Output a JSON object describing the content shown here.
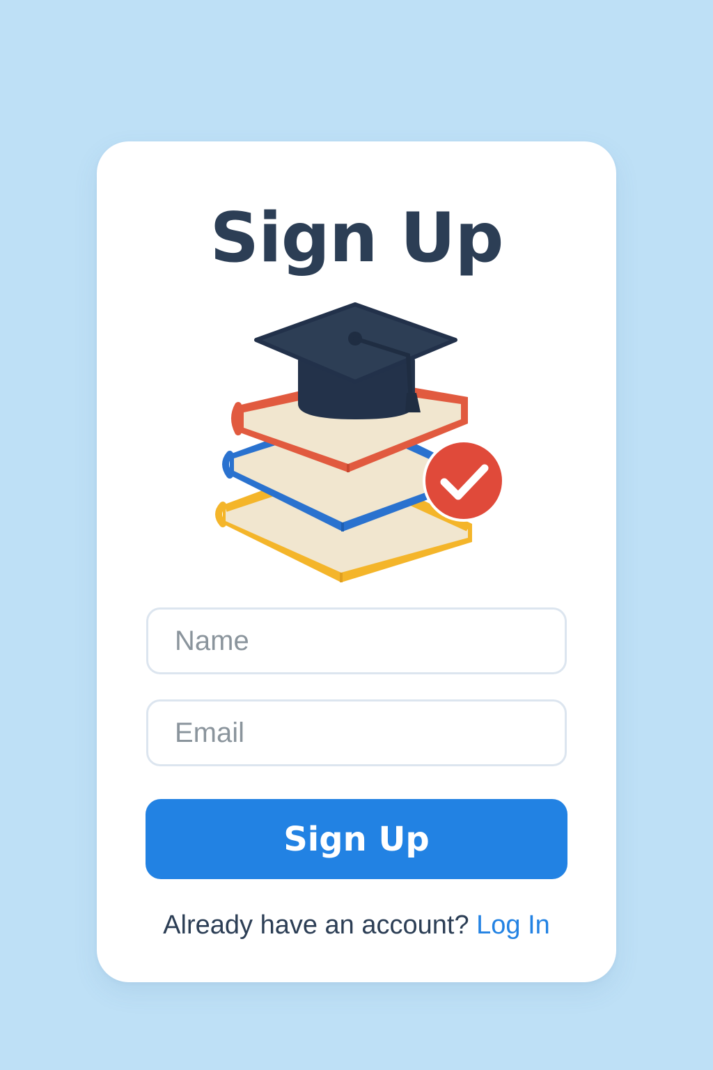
{
  "title": "Sign Up",
  "illustration": {
    "icon": "graduation-books-icon",
    "colors": {
      "cap": "#2d3e55",
      "book_top": "#e15a3f",
      "book_middle": "#2a72cf",
      "book_bottom": "#f4b52a",
      "pages": "#f1e6cf",
      "check_badge": "#e04a3a"
    }
  },
  "form": {
    "name_placeholder": "Name",
    "email_placeholder": "Email",
    "submit_label": "Sign Up"
  },
  "footer": {
    "prompt": "Already have an account?",
    "link_label": "Log In"
  },
  "colors": {
    "background": "#bee0f6",
    "card": "#ffffff",
    "accent": "#2282e3",
    "text": "#2c3e55"
  }
}
